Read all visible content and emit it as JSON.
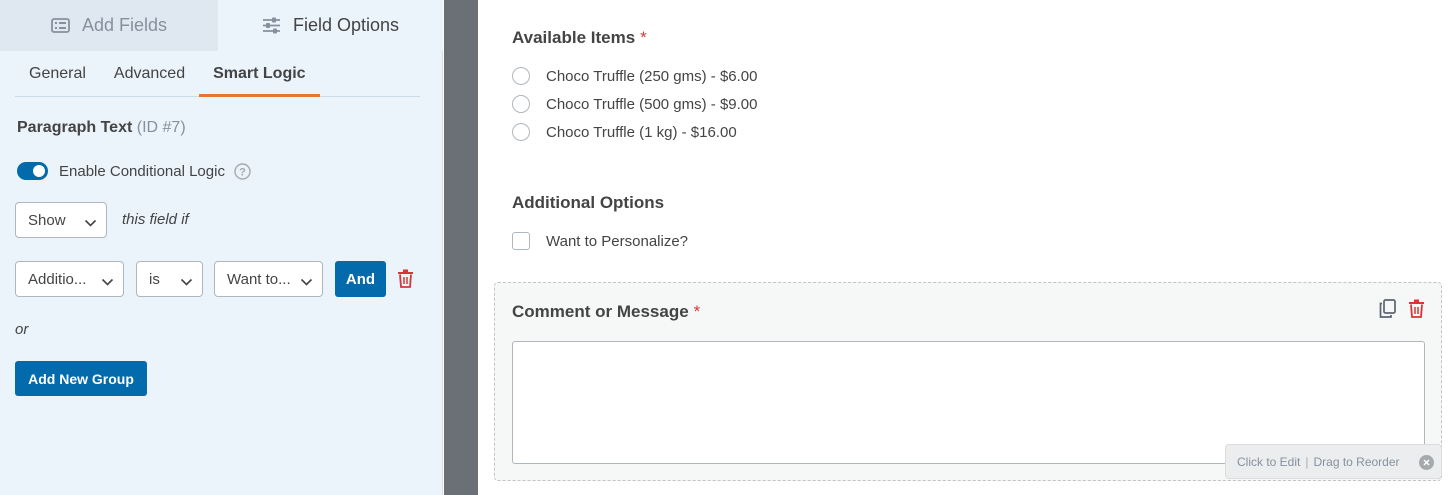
{
  "sidebar": {
    "top_tabs": [
      {
        "label": "Add Fields",
        "icon": "list-icon"
      },
      {
        "label": "Field Options",
        "icon": "sliders-icon"
      }
    ],
    "sub_tabs": [
      "General",
      "Advanced",
      "Smart Logic"
    ],
    "active_sub_tab": "Smart Logic",
    "field_name": "Paragraph Text",
    "field_id": "(ID #7)",
    "conditional_logic": {
      "label": "Enable Conditional Logic",
      "enabled": true,
      "action_select": "Show",
      "action_suffix": "this field if",
      "rule": {
        "field_select": "Additio...",
        "operator_select": "is",
        "value_select": "Want to..."
      },
      "and_label": "And",
      "or_label": "or",
      "add_group_label": "Add New Group"
    }
  },
  "form": {
    "available_items": {
      "label": "Available Items",
      "required_mark": "*",
      "options": [
        "Choco Truffle (250 gms) - $6.00",
        "Choco Truffle (500 gms) - $9.00",
        "Choco Truffle (1 kg) - $16.00"
      ]
    },
    "additional_options": {
      "label": "Additional Options",
      "options": [
        "Want to Personalize?"
      ]
    },
    "comment": {
      "label": "Comment or Message",
      "required_mark": "*"
    },
    "hint": {
      "edit": "Click to Edit",
      "separator": "|",
      "reorder": "Drag to Reorder"
    }
  },
  "colors": {
    "accent": "#036aab",
    "tab_underline": "#e27730",
    "danger": "#d63637",
    "sidebar_bg": "#ebf3fb"
  }
}
